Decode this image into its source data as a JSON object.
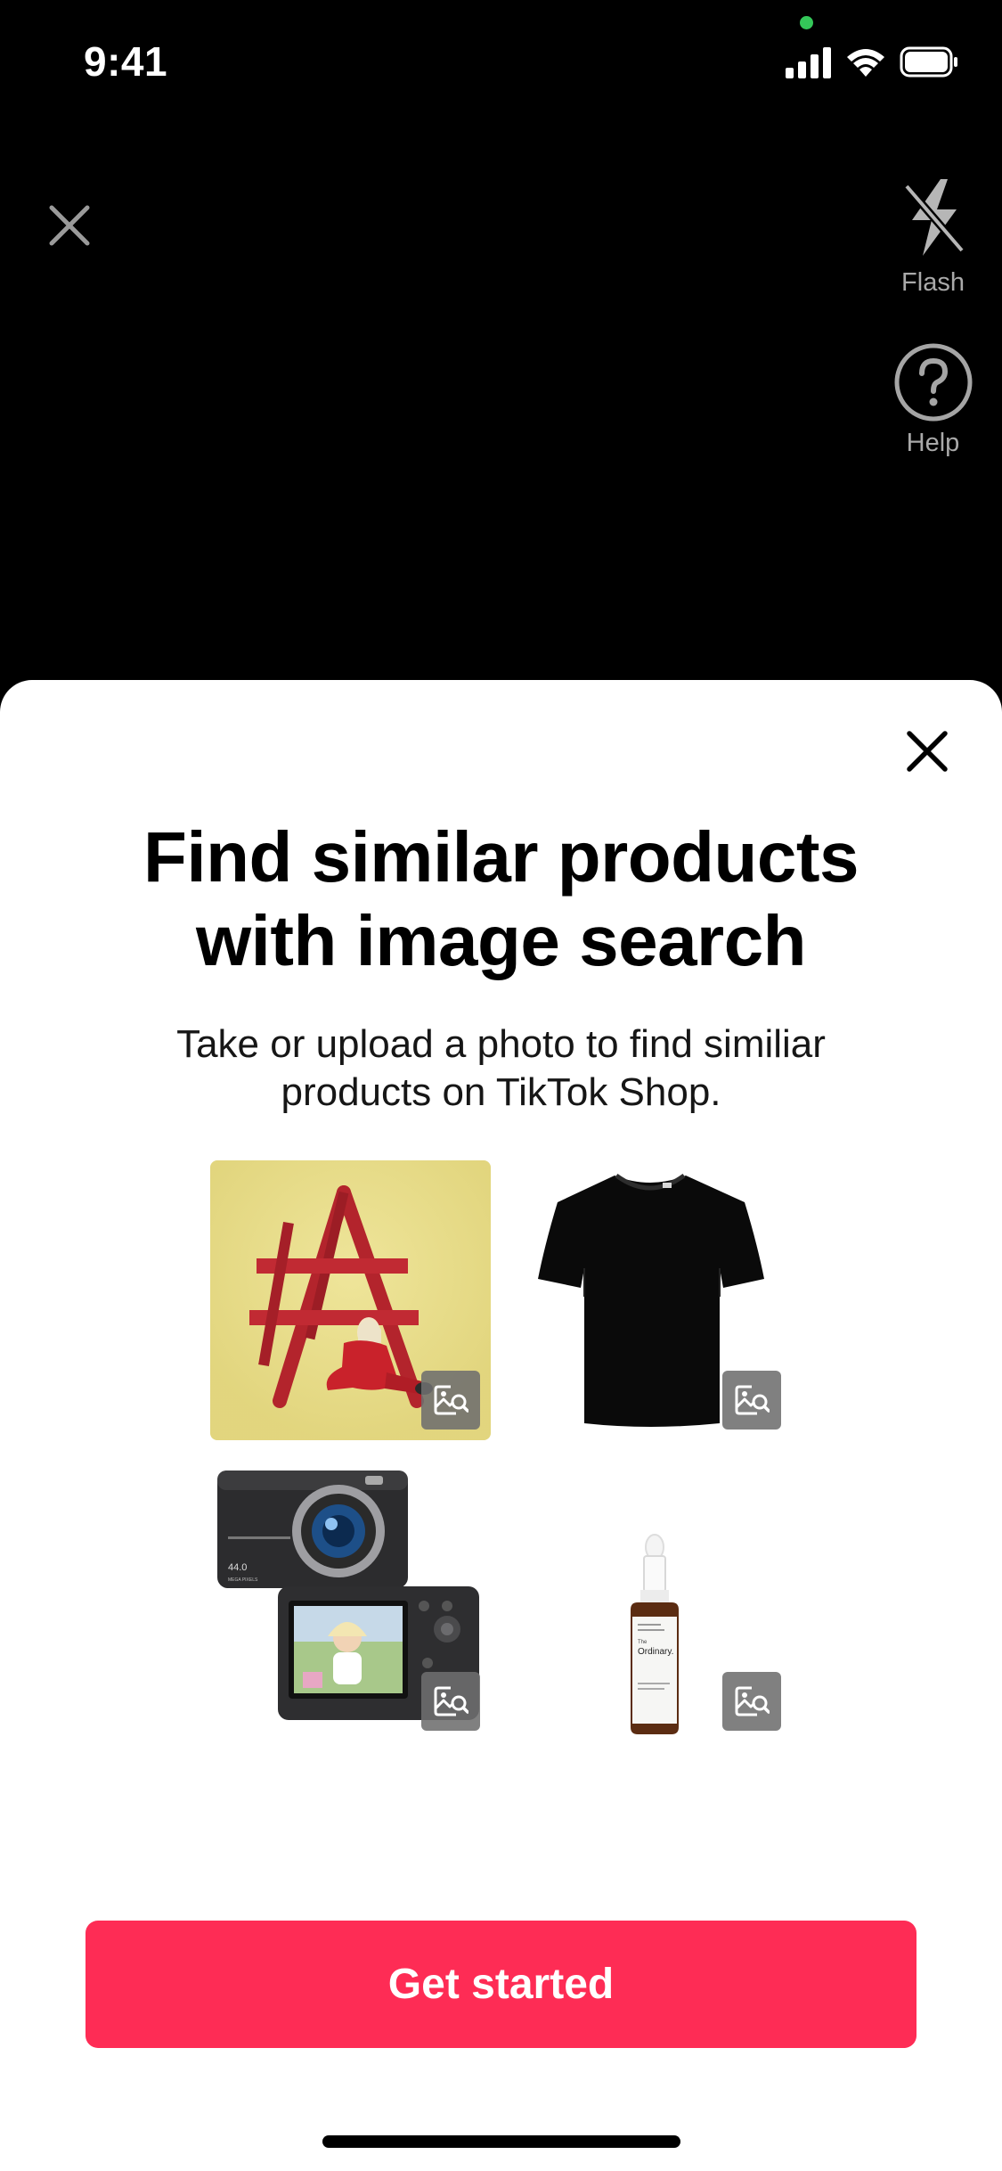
{
  "status_bar": {
    "time": "9:41"
  },
  "camera": {
    "flash_label": "Flash",
    "help_label": "Help"
  },
  "sheet": {
    "title_line1": "Find similar products",
    "title_line2": "with image search",
    "subtitle_line1": "Take or upload a photo to find similiar",
    "subtitle_line2": "products on TikTok Shop.",
    "cta_label": "Get started",
    "examples": [
      {
        "icon": "ladder-album-photo"
      },
      {
        "icon": "black-tshirt-photo"
      },
      {
        "icon": "digital-camera-photo",
        "camera_text_1": "44.0",
        "camera_text_2": "MEGA PIXELS"
      },
      {
        "icon": "serum-bottle-photo",
        "bottle_text_1": "The",
        "bottle_text_2": "Ordinary."
      }
    ]
  },
  "colors": {
    "accent": "#fe2c55",
    "status_green": "#34c759",
    "background_camera": "#000000",
    "sheet_background": "#ffffff"
  }
}
